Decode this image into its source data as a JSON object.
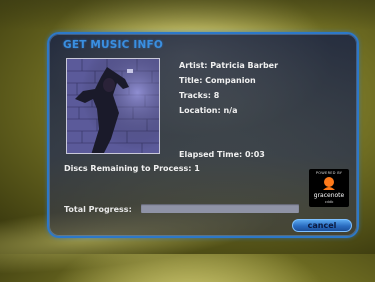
{
  "dialog": {
    "title": "GET MUSIC INFO",
    "artist": "Artist: Patricia Barber",
    "album_title": "Title: Companion",
    "tracks": "Tracks: 8",
    "location": "Location: n/a",
    "elapsed": "Elapsed Time: 0:03",
    "discs_remaining": "Discs Remaining to Process: 1",
    "progress_label": "Total Progress:",
    "progress_fraction": 0.0,
    "cancel_label": "cancel"
  },
  "badge": {
    "powered_by": "POWERED BY",
    "brand": "gracenote",
    "sub": "cddb"
  },
  "colors": {
    "accent": "#3a8fe0",
    "panel_border": "#2d78c8",
    "text": "#f0f0f0"
  },
  "icons": {
    "badge_logo": "gracenote-logo-icon",
    "album_art": "album-cover-image"
  }
}
